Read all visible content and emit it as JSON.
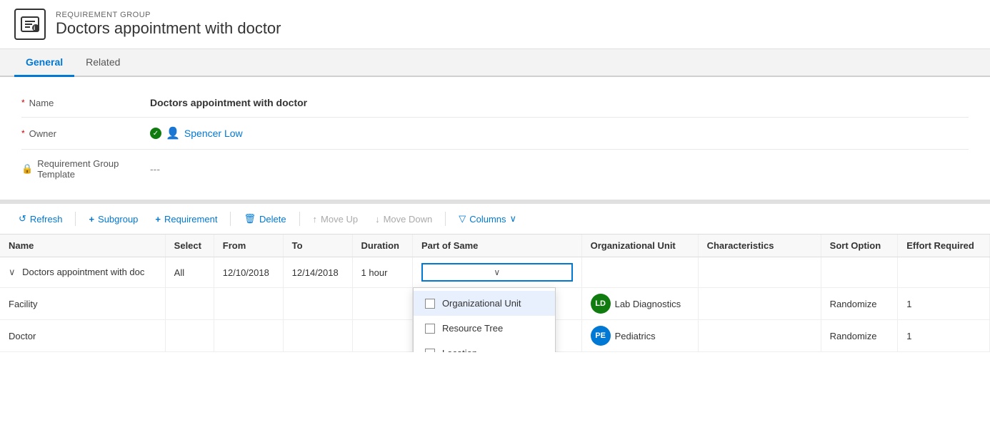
{
  "header": {
    "category": "REQUIREMENT GROUP",
    "title": "Doctors appointment with doctor",
    "icon_label": "req-group-icon"
  },
  "tabs": [
    {
      "label": "General",
      "active": true
    },
    {
      "label": "Related",
      "active": false
    }
  ],
  "form": {
    "fields": [
      {
        "label": "Name",
        "required": true,
        "value": "Doctors appointment with doctor",
        "bold": true
      },
      {
        "label": "Owner",
        "required": true,
        "type": "owner",
        "value": "Spencer Low"
      },
      {
        "label": "Requirement Group Template",
        "required": false,
        "type": "lock",
        "value": "---"
      }
    ]
  },
  "toolbar": {
    "buttons": [
      {
        "icon": "↺",
        "label": "Refresh",
        "disabled": false
      },
      {
        "icon": "+",
        "label": "Subgroup",
        "disabled": false
      },
      {
        "icon": "+",
        "label": "Requirement",
        "disabled": false
      },
      {
        "icon": "🗑",
        "label": "Delete",
        "disabled": false
      },
      {
        "icon": "↑",
        "label": "Move Up",
        "disabled": true
      },
      {
        "icon": "↓",
        "label": "Move Down",
        "disabled": true
      },
      {
        "icon": "▽",
        "label": "Columns",
        "disabled": false,
        "has_chevron": true
      }
    ]
  },
  "table": {
    "columns": [
      "Name",
      "Select",
      "From",
      "To",
      "Duration",
      "Part of Same",
      "Organizational Unit",
      "Characteristics",
      "Sort Option",
      "Effort Required"
    ],
    "rows": [
      {
        "type": "parent",
        "name": "Doctors appointment with doc",
        "select": "All",
        "from": "12/10/2018",
        "to": "12/14/2018",
        "duration": "1 hour",
        "partofsame": "",
        "orgunit": "",
        "characteristics": "",
        "sort_option": "",
        "effort": "",
        "has_dropdown": true,
        "dropdown_open": true
      },
      {
        "type": "child",
        "name": "Facility",
        "select": "",
        "from": "",
        "to": "",
        "duration": "",
        "partofsame": "",
        "orgunit": "Lab Diagnostics",
        "orgunit_avatar": "LD",
        "orgunit_color": "avatar-ld",
        "characteristics": "",
        "sort_option": "Randomize",
        "effort": "1"
      },
      {
        "type": "child",
        "name": "Doctor",
        "select": "",
        "from": "",
        "to": "",
        "duration": "",
        "partofsame": "",
        "orgunit": "Pediatrics",
        "orgunit_avatar": "PE",
        "orgunit_color": "avatar-pe",
        "characteristics": "",
        "sort_option": "Randomize",
        "effort": "1"
      }
    ],
    "dropdown_options": [
      {
        "label": "Organizational Unit",
        "checked": false,
        "highlighted": true
      },
      {
        "label": "Resource Tree",
        "checked": false
      },
      {
        "label": "Location",
        "checked": false
      }
    ]
  }
}
